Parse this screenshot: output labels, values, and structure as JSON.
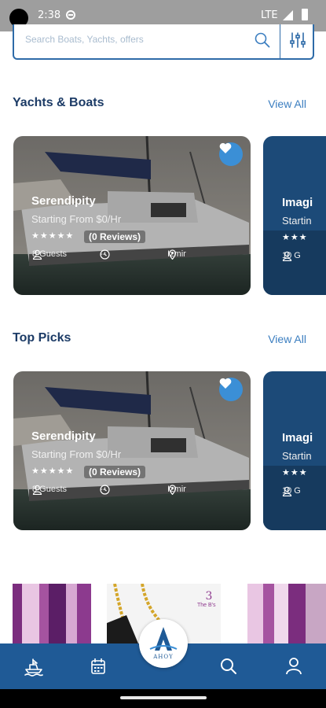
{
  "status_bar": {
    "time": "2:38",
    "network": "LTE"
  },
  "search": {
    "placeholder": "Search Boats, Yachts, offers"
  },
  "sections": [
    {
      "title": "Yachts & Boats",
      "view_all": "View All"
    },
    {
      "title": "Top Picks",
      "view_all": "View All"
    }
  ],
  "cards": [
    {
      "title": "Serendipity",
      "price": "Starting From $0/Hr",
      "stars": "★★★★★",
      "reviews": "(0 Reviews)",
      "guests": "8 Guests",
      "duration": "--",
      "location": "Izmir"
    },
    {
      "title": "Serendipity",
      "price": "Starting From $0/Hr",
      "stars": "★★★★★",
      "reviews": "(0 Reviews)",
      "guests": "8 Guests",
      "duration": "--",
      "location": "Izmir"
    }
  ],
  "peek_cards": [
    {
      "title": "Imagi",
      "sub": "Startin",
      "stars": "★★★",
      "guests": "10 G"
    },
    {
      "title": "Imagi",
      "sub": "Startin",
      "stars": "★★★",
      "guests": "10 G"
    }
  ],
  "banner": {
    "brand_text": "The B's"
  },
  "logo": {
    "text": "AHOY"
  },
  "colors": {
    "brand_blue": "#1f5a96",
    "accent": "#3b7ec0",
    "heading": "#1c3b66",
    "heart": "#3b8fd6"
  },
  "nav_icons": [
    "boat-icon",
    "calendar-icon",
    "search-icon",
    "profile-icon"
  ]
}
